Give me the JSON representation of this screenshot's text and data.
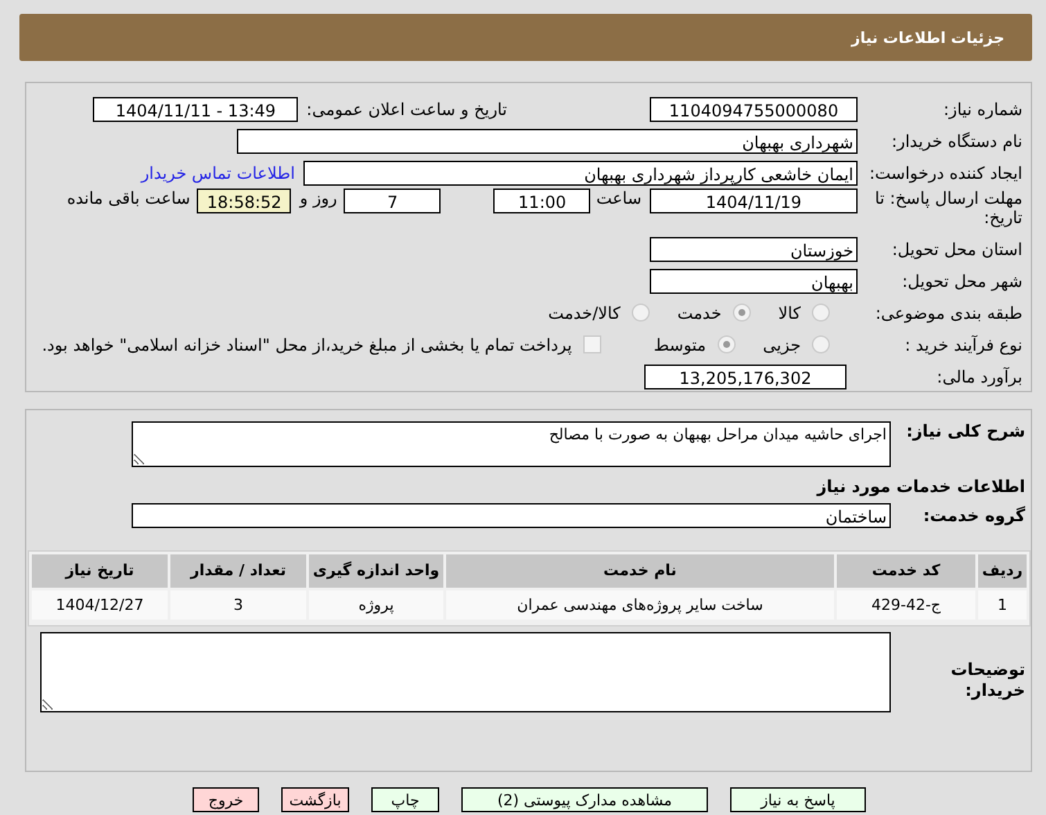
{
  "header": {
    "title": "جزئیات اطلاعات نیاز"
  },
  "need_number": {
    "label": "شماره نیاز:",
    "value": "1104094755000080"
  },
  "announce": {
    "label": "تاریخ و ساعت اعلان عمومی:",
    "value": "1404/11/11 - 13:49"
  },
  "buyer_org": {
    "label": "نام دستگاه خریدار:",
    "value": "شهرداری بهبهان"
  },
  "requester": {
    "label": "ایجاد کننده درخواست:",
    "value": "ایمان خاشعی کارپرداز شهرداری بهبهان",
    "link": "اطلاعات تماس خریدار"
  },
  "deadline": {
    "label": "مهلت ارسال پاسخ: تا تاریخ:",
    "date": "1404/11/19",
    "time_label": "ساعت",
    "time": "11:00",
    "days": "7",
    "days_label": "روز و",
    "remaining": "18:58:52",
    "remaining_label": "ساعت باقی مانده"
  },
  "province": {
    "label": "استان محل تحویل:",
    "value": "خوزستان"
  },
  "city": {
    "label": "شهر محل تحویل:",
    "value": "بهبهان"
  },
  "category": {
    "label": "طبقه بندی موضوعی:",
    "options": [
      {
        "label": "کالا",
        "selected": false
      },
      {
        "label": "خدمت",
        "selected": true
      },
      {
        "label": "کالا/خدمت",
        "selected": false
      }
    ]
  },
  "process": {
    "label": "نوع فرآیند خرید :",
    "options": [
      {
        "label": "جزیی",
        "selected": false
      },
      {
        "label": "متوسط",
        "selected": true
      }
    ],
    "payment": {
      "checked": false,
      "text": "پرداخت تمام یا بخشی از مبلغ خرید،از محل \"اسناد خزانه اسلامی\" خواهد بود."
    }
  },
  "budget": {
    "label": "برآورد مالی:",
    "value": "13,205,176,302"
  },
  "description": {
    "label": "شرح کلی نیاز:",
    "value": "اجرای حاشیه میدان مراحل بهبهان به صورت با مصالح"
  },
  "services_heading": "اطلاعات خدمات مورد نیاز",
  "service_group": {
    "label": "گروه خدمت:",
    "value": "ساختمان"
  },
  "table": {
    "columns": [
      "ردیف",
      "کد خدمت",
      "نام خدمت",
      "واحد اندازه گیری",
      "تعداد / مقدار",
      "تاریخ نیاز"
    ],
    "rows": [
      [
        "1",
        "ج-42-429",
        "ساخت سایر پروژه‌های مهندسی عمران",
        "پروژه",
        "3",
        "1404/12/27"
      ]
    ]
  },
  "buyer_notes": {
    "label": "توضیحات خریدار:"
  },
  "buttons": [
    {
      "label": "پاسخ به نیاز",
      "kind": "action"
    },
    {
      "label": "مشاهده مدارک پیوستی (2)",
      "kind": "action"
    },
    {
      "label": "چاپ",
      "kind": "action"
    },
    {
      "label": "بازگشت",
      "kind": "danger"
    },
    {
      "label": "خروج",
      "kind": "danger"
    }
  ]
}
